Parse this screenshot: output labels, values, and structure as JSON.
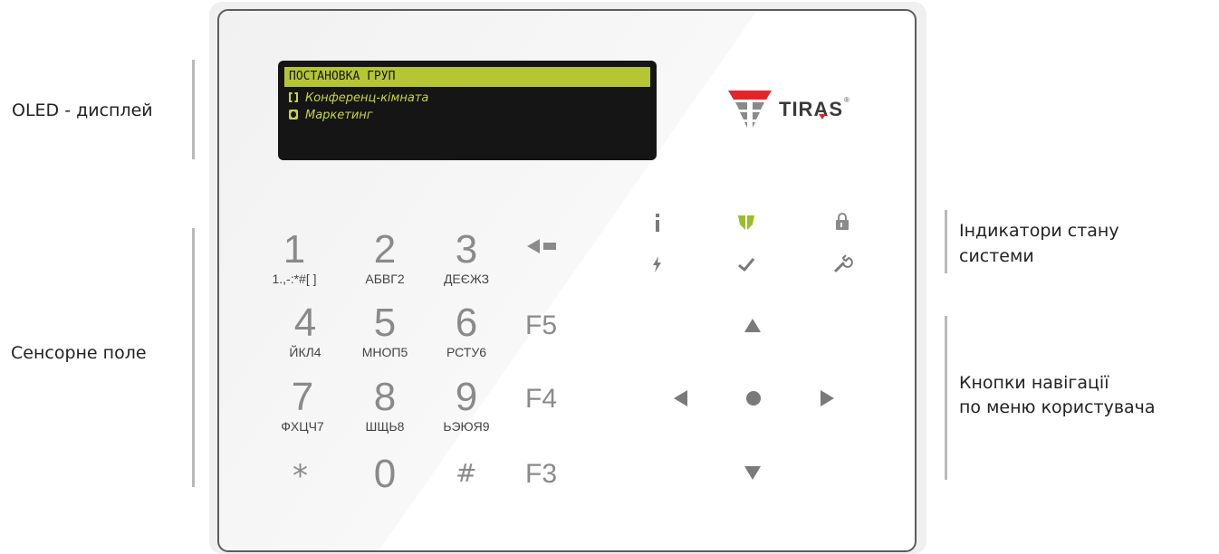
{
  "labels": {
    "oled": "OLED - дисплей",
    "touch_field": "Сенсорне поле",
    "indicators_line1": "Індикатори стану",
    "indicators_line2": "системи",
    "nav_line1": "Кнопки навігації",
    "nav_line2": "по меню користувача"
  },
  "display": {
    "title": "ПОСТАНОВКА ГРУП",
    "rows": [
      {
        "text": "Конференц-кімната",
        "checked": false
      },
      {
        "text": "Маркетинг",
        "checked": true
      }
    ]
  },
  "logo": {
    "text": "TIRAS",
    "brand_color": "#e5232b"
  },
  "keypad": {
    "keys": [
      {
        "digit": "1",
        "letters": "1.,-:*#[ ]"
      },
      {
        "digit": "2",
        "letters": "АБВГ2"
      },
      {
        "digit": "3",
        "letters": "ДЕЄЖЗ"
      },
      {
        "digit": "4",
        "letters": "ЙКЛ4"
      },
      {
        "digit": "5",
        "letters": "МНОП5"
      },
      {
        "digit": "6",
        "letters": "РСТУ6"
      },
      {
        "digit": "7",
        "letters": "ФХЦЧ7"
      },
      {
        "digit": "8",
        "letters": "ШЩЬ8"
      },
      {
        "digit": "9",
        "letters": "ЬЭЮЯ9"
      }
    ],
    "star": "*",
    "zero": "0",
    "hash": "#",
    "backspace_icon": "backspace-arrow-icon",
    "f5": "F5",
    "f4": "F4",
    "f3": "F3"
  },
  "indicators": {
    "icons": [
      "info-icon",
      "armed-shield-icon",
      "lock-icon",
      "power-icon",
      "ready-check-icon",
      "service-wrench-icon"
    ],
    "active_color": "#9bbd2a"
  },
  "navigation": {
    "icons": [
      "up-arrow-icon",
      "left-arrow-icon",
      "ok-dot-icon",
      "right-arrow-icon",
      "down-arrow-icon"
    ]
  }
}
